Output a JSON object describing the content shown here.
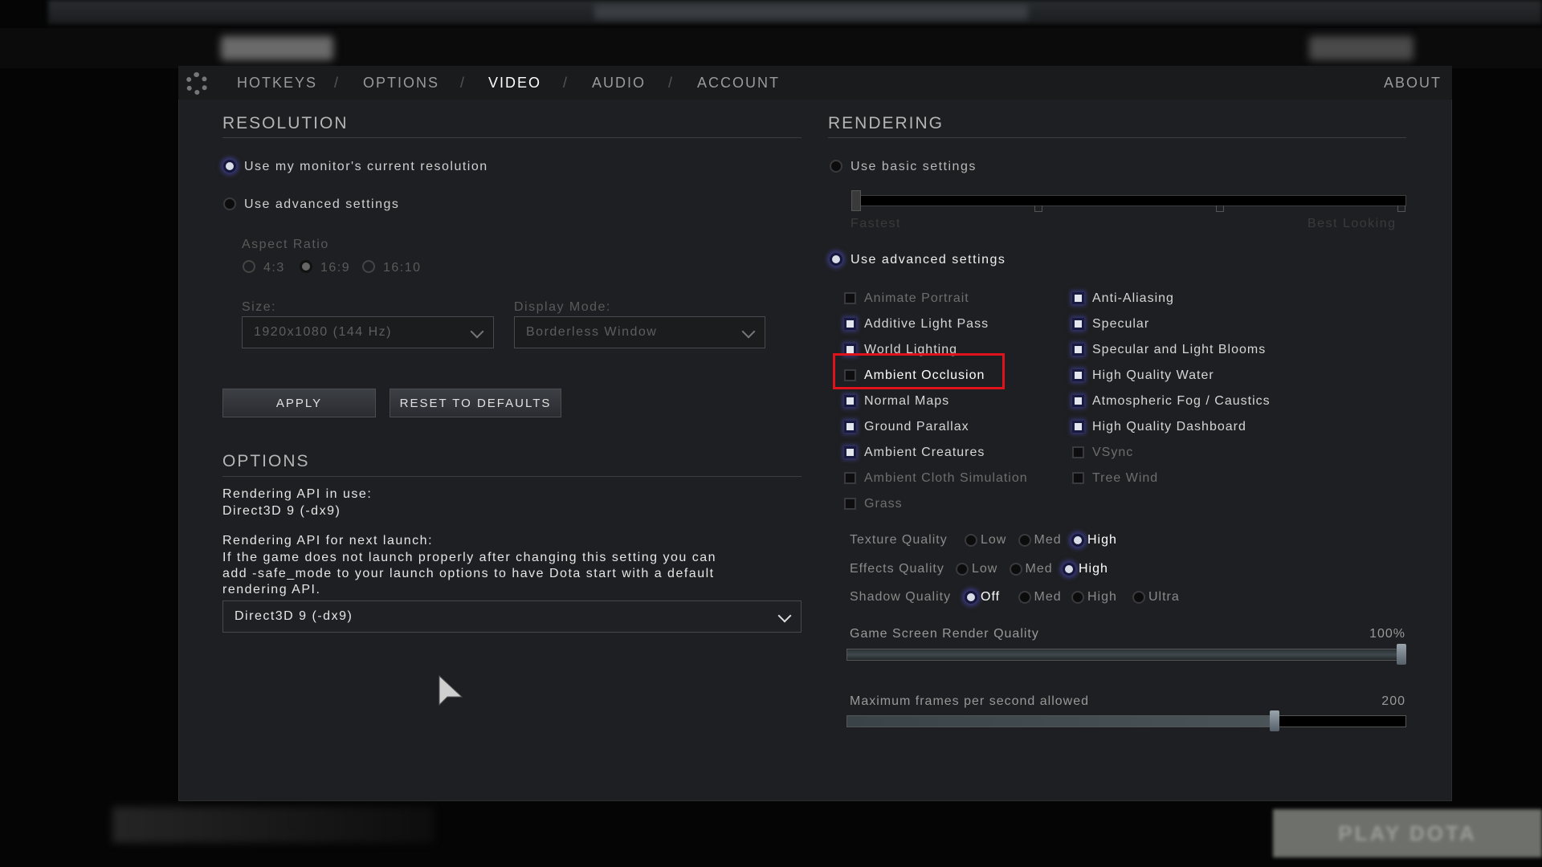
{
  "nav_tabs": [
    {
      "label": "HOTKEYS"
    },
    {
      "label": "OPTIONS"
    },
    {
      "label": "VIDEO",
      "active": true
    },
    {
      "label": "AUDIO"
    },
    {
      "label": "ACCOUNT"
    }
  ],
  "nav_separator": "/",
  "about": "ABOUT",
  "resolution": {
    "title": "RESOLUTION",
    "use_current": "Use my monitor's current resolution",
    "use_advanced": "Use advanced settings",
    "selected": "Use my monitor's current resolution",
    "aspect_label": "Aspect Ratio",
    "aspect_options": [
      "4:3",
      "16:9",
      "16:10"
    ],
    "aspect_selected": "16:9",
    "size_label": "Size:",
    "size_value": "1920x1080 (144 Hz)",
    "display_mode_label": "Display Mode:",
    "display_mode_value": "Borderless Window",
    "apply": "APPLY",
    "reset": "RESET TO DEFAULTS"
  },
  "options": {
    "title": "OPTIONS",
    "api_in_use_label": "Rendering API in use:",
    "api_in_use_value": "Direct3D 9 (-dx9)",
    "api_next_label": "Rendering API for next launch:",
    "api_note_1": "If the game does not launch properly after changing this setting you can",
    "api_note_2": "add -safe_mode to your launch options to have Dota start with a default",
    "api_note_3": "rendering API.",
    "api_next_value": "Direct3D 9 (-dx9)"
  },
  "rendering": {
    "title": "RENDERING",
    "basic": "Use basic settings",
    "basic_min": "Fastest",
    "basic_max": "Best Looking",
    "basic_level": 0,
    "advanced": "Use advanced settings",
    "selected": "Use advanced settings",
    "col1": [
      {
        "label": "Animate Portrait",
        "checked": false,
        "disabled": true
      },
      {
        "label": "Additive Light Pass",
        "checked": true
      },
      {
        "label": "World Lighting",
        "checked": true
      },
      {
        "label": "Ambient Occlusion",
        "checked": false,
        "highlighted": true
      },
      {
        "label": "Normal Maps",
        "checked": true
      },
      {
        "label": "Ground Parallax",
        "checked": true
      },
      {
        "label": "Ambient Creatures",
        "checked": true
      },
      {
        "label": "Ambient Cloth Simulation",
        "checked": false,
        "disabled": true
      },
      {
        "label": "Grass",
        "checked": false,
        "disabled": true
      }
    ],
    "col2": [
      {
        "label": "Anti-Aliasing",
        "checked": true
      },
      {
        "label": "Specular",
        "checked": true
      },
      {
        "label": "Specular and Light Blooms",
        "checked": true
      },
      {
        "label": "High Quality Water",
        "checked": true
      },
      {
        "label": "Atmospheric Fog / Caustics",
        "checked": true
      },
      {
        "label": "High Quality Dashboard",
        "checked": true
      },
      {
        "label": "VSync",
        "checked": false,
        "disabled": true
      },
      {
        "label": "Tree Wind",
        "checked": false,
        "disabled": true
      }
    ],
    "quality": [
      {
        "label": "Texture Quality",
        "options": [
          "Low",
          "Med",
          "High"
        ],
        "selected": "High"
      },
      {
        "label": "Effects Quality",
        "options": [
          "Low",
          "Med",
          "High"
        ],
        "selected": "High"
      },
      {
        "label": "Shadow Quality",
        "options": [
          "Off",
          "Med",
          "High",
          "Ultra"
        ],
        "selected": "Off"
      }
    ],
    "render_quality_label": "Game Screen Render Quality",
    "render_quality_value": "100%",
    "render_quality_fraction": 1.0,
    "fps_label": "Maximum frames per second allowed",
    "fps_value": "200",
    "fps_fraction": 0.77
  },
  "highlight_color": "#e0121b",
  "accent_color": "#5050c8",
  "footer": {
    "play_label": "PLAY DOTA"
  }
}
